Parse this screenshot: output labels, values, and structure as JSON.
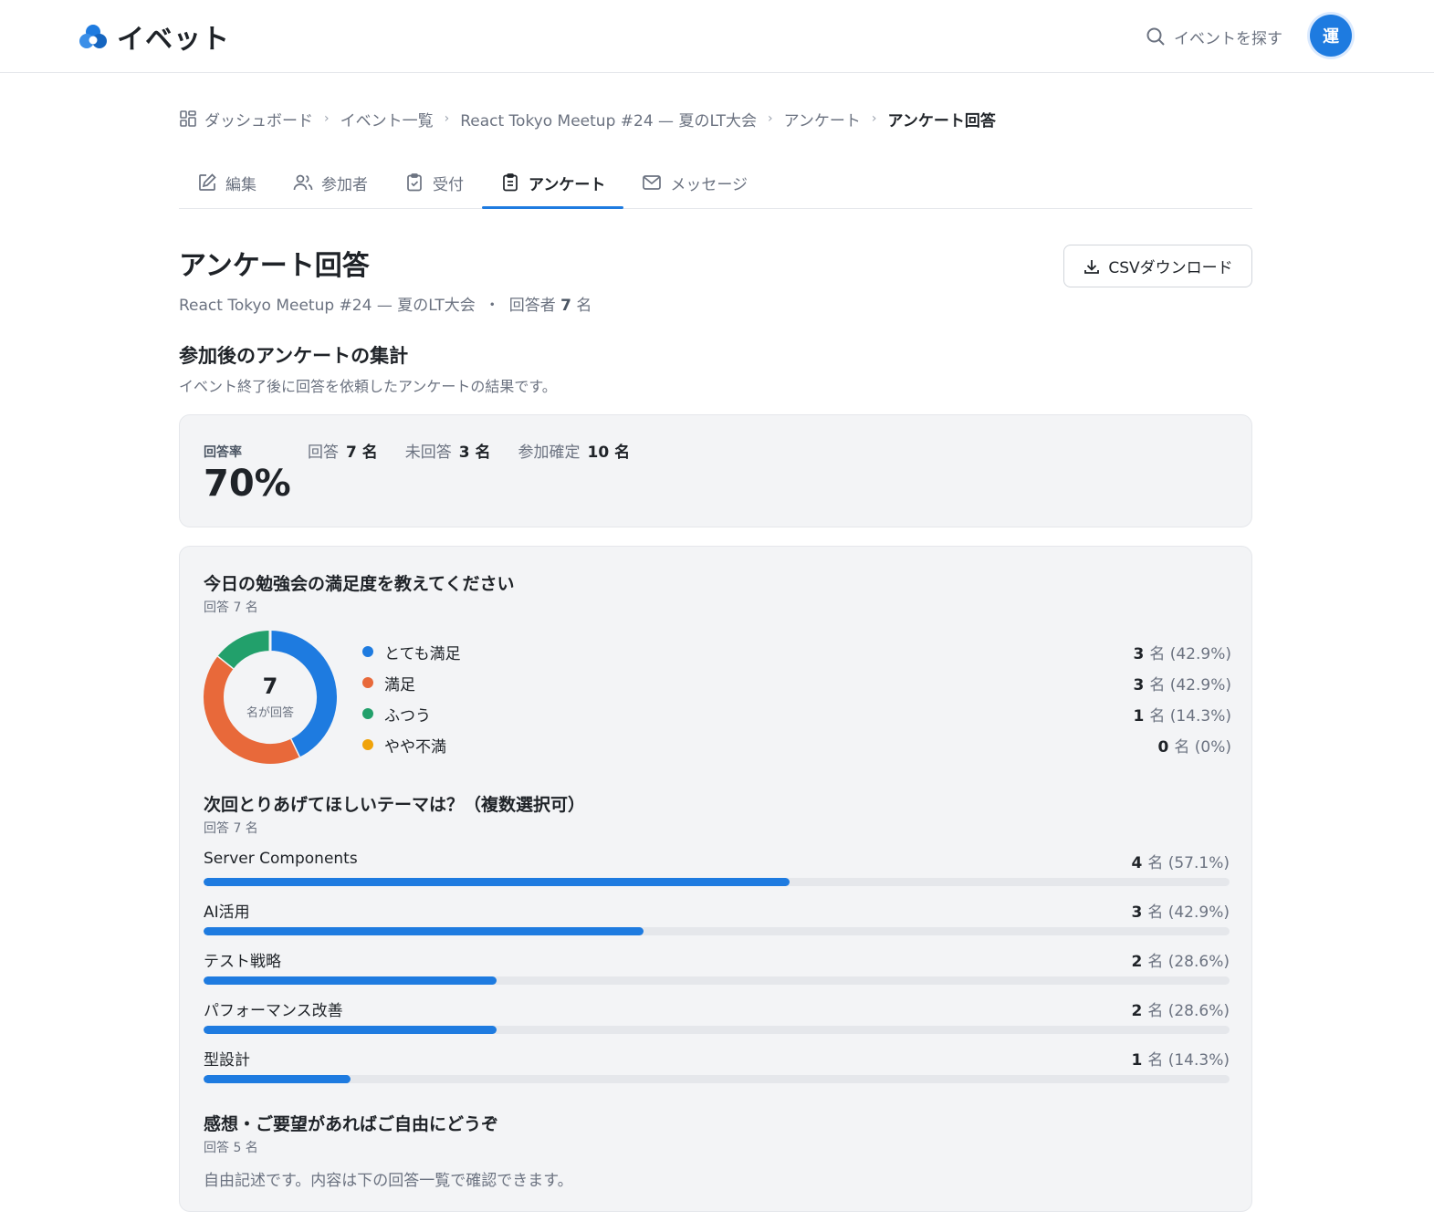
{
  "header": {
    "app_name": "イベット",
    "search_label": "イベントを探す",
    "avatar_initial": "運",
    "accent_color": "#1e7be0"
  },
  "breadcrumb": [
    {
      "label": "ダッシュボード",
      "icon": "dashboard-icon"
    },
    {
      "label": "イベント一覧"
    },
    {
      "label": "React Tokyo Meetup #24 — 夏のLT大会"
    },
    {
      "label": "アンケート"
    },
    {
      "label": "アンケート回答"
    }
  ],
  "tabs": [
    {
      "label": "編集",
      "icon": "edit-icon",
      "active": false
    },
    {
      "label": "参加者",
      "icon": "users-icon",
      "active": false
    },
    {
      "label": "受付",
      "icon": "clipboard-check-icon",
      "active": false
    },
    {
      "label": "アンケート",
      "icon": "clipboard-list-icon",
      "active": true
    },
    {
      "label": "メッセージ",
      "icon": "mail-icon",
      "active": false
    }
  ],
  "page": {
    "title": "アンケート回答",
    "subtitle_event": "React Tokyo Meetup #24 — 夏のLT大会",
    "subtitle_bullet": "・",
    "subtitle_respondents_prefix": "回答者",
    "subtitle_respondents_count": "7",
    "subtitle_respondents_unit": "名",
    "csv_button": "CSVダウンロード",
    "section_title": "参加後のアンケートの集計",
    "section_desc": "イベント終了後に回答を依頼したアンケートの結果です。"
  },
  "stats": {
    "rate_label": "回答率",
    "rate_value": "70%",
    "items": [
      {
        "label": "回答",
        "value": "7 名"
      },
      {
        "label": "未回答",
        "value": "3 名"
      },
      {
        "label": "参加確定",
        "value": "10 名"
      }
    ]
  },
  "questions": {
    "q1": {
      "title": "今日の勉強会の満足度を教えてください",
      "count": "回答 7 名",
      "center_value": "7",
      "center_caption": "名が回答",
      "options": [
        {
          "label": "とても満足",
          "count": "3",
          "detail": "名 (42.9%)",
          "color": "#1e7be0"
        },
        {
          "label": "満足",
          "count": "3",
          "detail": "名 (42.9%)",
          "color": "#e8693a"
        },
        {
          "label": "ふつう",
          "count": "1",
          "detail": "名 (14.3%)",
          "color": "#22a06b"
        },
        {
          "label": "やや不満",
          "count": "0",
          "detail": "名 (0%)",
          "color": "#f0a30a"
        }
      ]
    },
    "q2": {
      "title": "次回とりあげてほしいテーマは？（複数選択可）",
      "count": "回答 7 名",
      "options": [
        {
          "label": "Server Components",
          "count": "4",
          "detail": "名 (57.1%)",
          "percent": 57.1
        },
        {
          "label": "AI活用",
          "count": "3",
          "detail": "名 (42.9%)",
          "percent": 42.9
        },
        {
          "label": "テスト戦略",
          "count": "2",
          "detail": "名 (28.6%)",
          "percent": 28.6
        },
        {
          "label": "パフォーマンス改善",
          "count": "2",
          "detail": "名 (28.6%)",
          "percent": 28.6
        },
        {
          "label": "型設計",
          "count": "1",
          "detail": "名 (14.3%)",
          "percent": 14.3
        }
      ]
    },
    "q3": {
      "title": "感想・ご要望があればご自由にどうぞ",
      "count": "回答 5 名",
      "note": "自由記述です。内容は下の回答一覧で確認できます。"
    }
  },
  "chart_data": {
    "type": "pie",
    "categories": [
      "とても満足",
      "満足",
      "ふつう",
      "やや不満"
    ],
    "values": [
      3,
      3,
      1,
      0
    ],
    "colors": [
      "#1e7be0",
      "#e8693a",
      "#22a06b",
      "#f0a30a"
    ]
  }
}
